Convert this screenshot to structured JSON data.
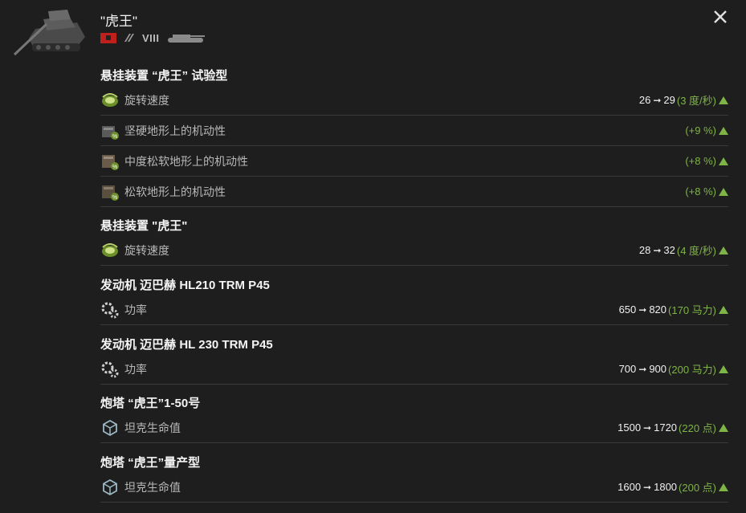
{
  "header": {
    "title": "\"虎王\"",
    "tier": "VIII"
  },
  "sections": [
    {
      "title": "悬挂装置 “虎王” 试验型",
      "rows": [
        {
          "label": "旋转速度",
          "icon": "traverse-icon",
          "from": "26",
          "to": "29",
          "delta": "(3 度/秒)"
        },
        {
          "label": "坚硬地形上的机动性",
          "icon": "hard-terrain-icon",
          "from": "",
          "to": "",
          "delta": "(+9 %)"
        },
        {
          "label": "中度松软地形上的机动性",
          "icon": "medium-terrain-icon",
          "from": "",
          "to": "",
          "delta": "(+8 %)"
        },
        {
          "label": "松软地形上的机动性",
          "icon": "soft-terrain-icon",
          "from": "",
          "to": "",
          "delta": "(+8 %)"
        }
      ]
    },
    {
      "title": "悬挂装置 \"虎王\"",
      "rows": [
        {
          "label": "旋转速度",
          "icon": "traverse-icon",
          "from": "28",
          "to": "32",
          "delta": "(4 度/秒)"
        }
      ]
    },
    {
      "title": "发动机 迈巴赫 HL210 TRM P45",
      "rows": [
        {
          "label": "功率",
          "icon": "gears-icon",
          "from": "650",
          "to": "820",
          "delta": "(170 马力)"
        }
      ]
    },
    {
      "title": "发动机 迈巴赫 HL 230 TRM P45",
      "rows": [
        {
          "label": "功率",
          "icon": "gears-icon",
          "from": "700",
          "to": "900",
          "delta": "(200 马力)"
        }
      ]
    },
    {
      "title": "炮塔 “虎王”1-50号",
      "rows": [
        {
          "label": "坦克生命值",
          "icon": "hitpoints-icon",
          "from": "1500",
          "to": "1720",
          "delta": "(220 点)"
        }
      ]
    },
    {
      "title": "炮塔 “虎王”量产型",
      "rows": [
        {
          "label": "坦克生命值",
          "icon": "hitpoints-icon",
          "from": "1600",
          "to": "1800",
          "delta": "(200 点)"
        }
      ]
    }
  ],
  "colors": {
    "accent_green": "#7fb446",
    "background": "#1e1e1e"
  }
}
